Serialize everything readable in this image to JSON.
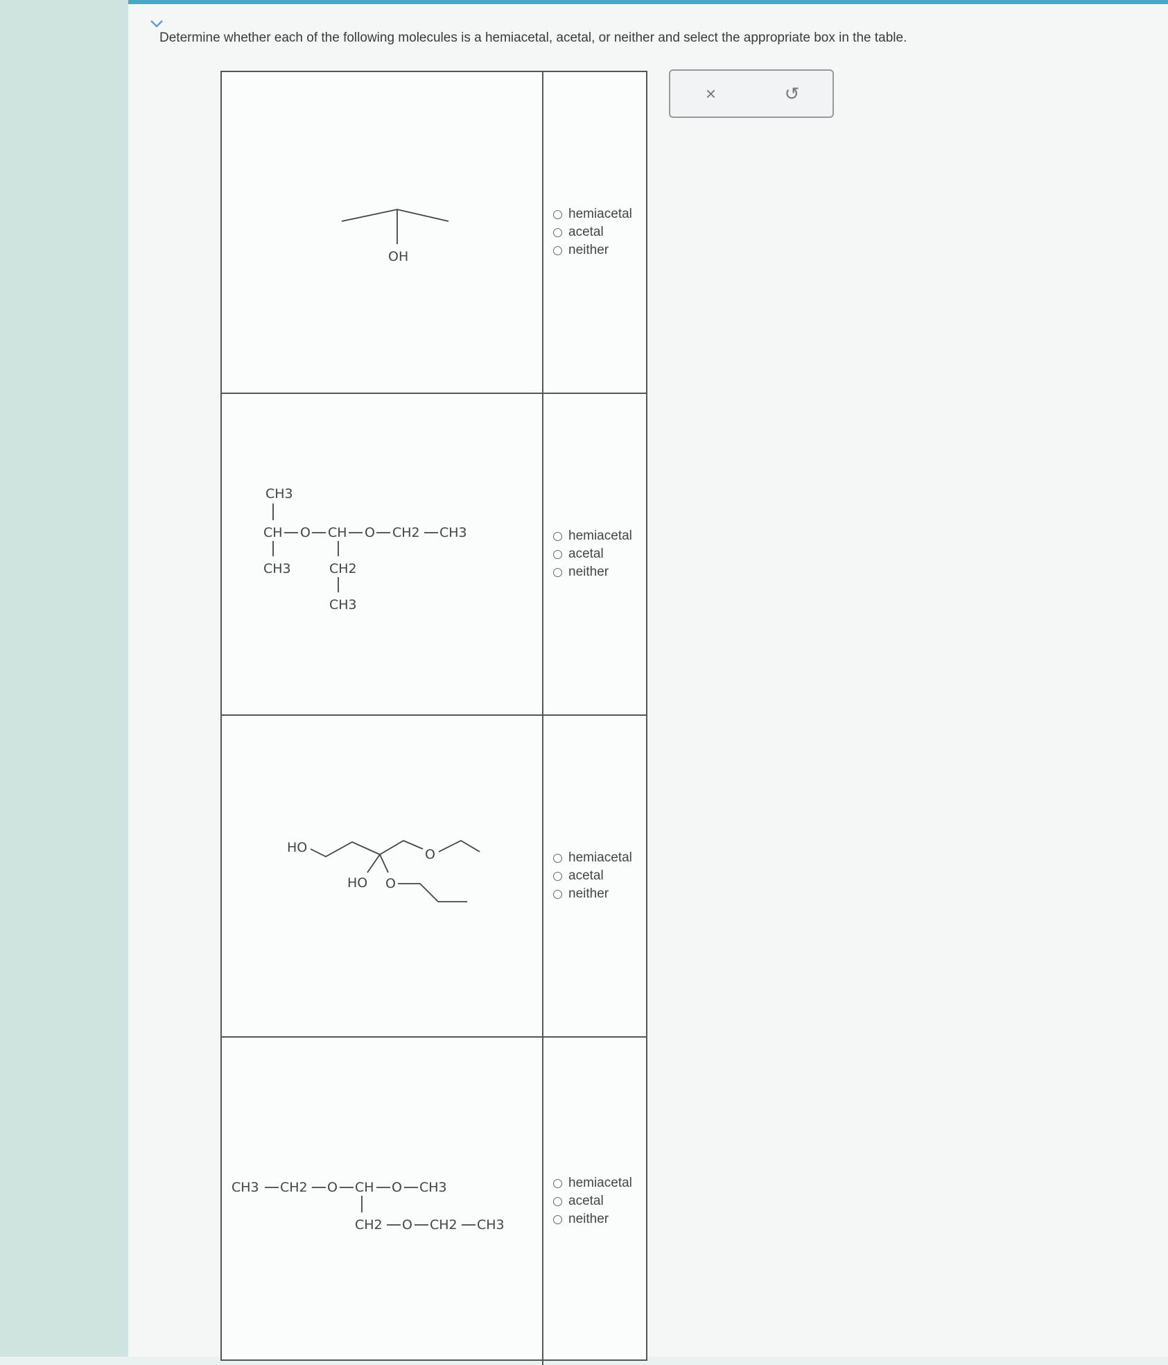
{
  "question": {
    "prompt": "Determine whether each of the following molecules is a hemiacetal, acetal, or neither and select the appropriate box in the table."
  },
  "options": [
    "hemiacetal",
    "acetal",
    "neither"
  ],
  "molecules": [
    {
      "labels": {
        "oh": "OH"
      }
    },
    {
      "labels": {
        "top": "CH3",
        "main_ch": "CH",
        "o1": "O",
        "ch2": "CH",
        "o2": "O",
        "ch2a": "CH2",
        "ch3a": "CH3",
        "bottom_left": "CH3",
        "branch_ch2": "CH2",
        "branch_ch3": "CH3"
      }
    },
    {
      "labels": {
        "ho1": "HO",
        "ho2": "HO",
        "o1": "O",
        "o2": "O"
      }
    },
    {
      "labels": {
        "c1": "CH3",
        "c2": "CH2",
        "o1": "O",
        "ch": "CH",
        "o2": "O",
        "c3": "CH3",
        "c4": "CH2",
        "o3": "O",
        "c5": "CH2",
        "c6": "CH3"
      }
    }
  ],
  "actions": {
    "clear_icon": "×",
    "undo_icon": "↺"
  }
}
